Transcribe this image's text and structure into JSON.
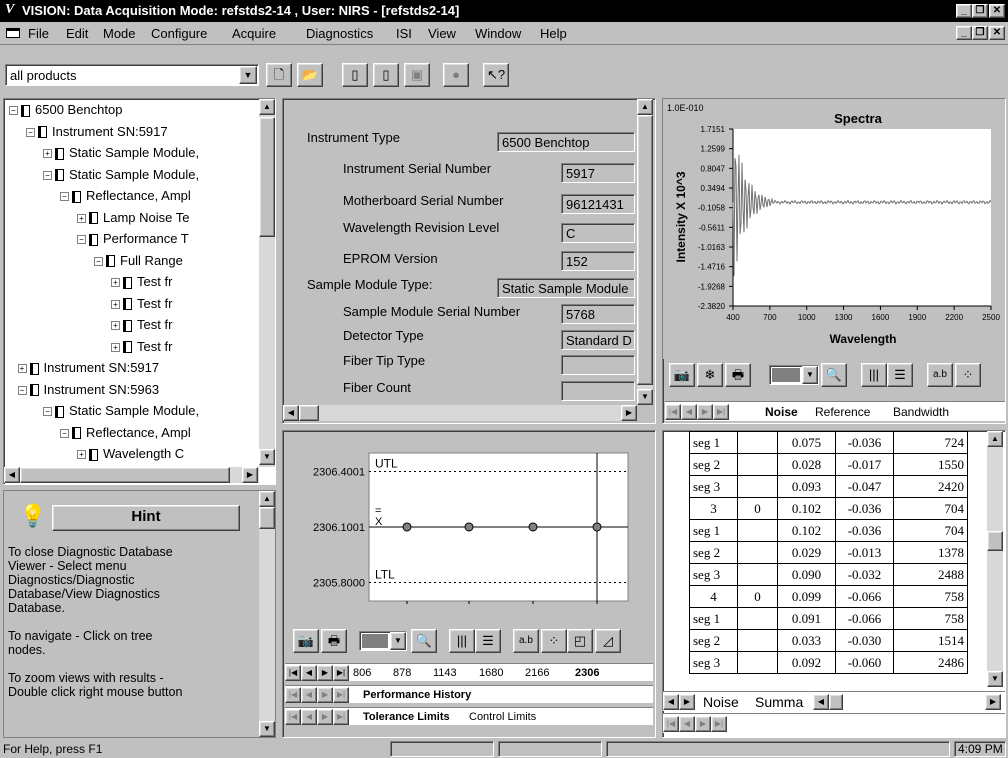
{
  "window": {
    "logo": "V",
    "title": "VISION: Data Acquisition Mode: refstds2-14 , User: NIRS - [refstds2-14]"
  },
  "menu": [
    "File",
    "Edit",
    "Mode",
    "Configure",
    "Acquire",
    "Diagnostics",
    "ISI",
    "View",
    "Window",
    "Help"
  ],
  "toolbar": {
    "product_filter": "all products"
  },
  "tree": [
    {
      "label": "6500 Benchtop",
      "level": 0,
      "pm": "−"
    },
    {
      "label": "Instrument SN:5917",
      "level": 1,
      "pm": "−"
    },
    {
      "label": "Static Sample Module,",
      "level": 2,
      "pm": "+"
    },
    {
      "label": "Static Sample Module,",
      "level": 2,
      "pm": "−"
    },
    {
      "label": "Reflectance, Ampl",
      "level": 3,
      "pm": "−"
    },
    {
      "label": "Lamp Noise Te",
      "level": 4,
      "pm": "+"
    },
    {
      "label": "Performance T",
      "level": 4,
      "pm": "−"
    },
    {
      "label": "Full Range",
      "level": 5,
      "pm": "−"
    },
    {
      "label": "Test fr",
      "level": 6,
      "pm": "+"
    },
    {
      "label": "Test fr",
      "level": 6,
      "pm": "+"
    },
    {
      "label": "Test fr",
      "level": 6,
      "pm": "+"
    },
    {
      "label": "Test fr",
      "level": 6,
      "pm": "+"
    },
    {
      "label": "Instrument SN:5917",
      "level": 0.5,
      "pm": "+"
    },
    {
      "label": "Instrument SN:5963",
      "level": 0.5,
      "pm": "−"
    },
    {
      "label": "Static Sample Module,",
      "level": 2,
      "pm": "−"
    },
    {
      "label": "Reflectance, Ampl",
      "level": 3,
      "pm": "−"
    },
    {
      "label": "Wavelength C",
      "level": 4,
      "pm": "+"
    }
  ],
  "hint": {
    "title": "Hint",
    "lines": [
      "To close Diagnostic Database",
      "Viewer - Select menu",
      "Diagnostics/Diagnostic",
      "Database/View Diagnostics",
      "Database.",
      "",
      "To navigate - Click on tree",
      "nodes.",
      "",
      "To zoom views with results -",
      "Double click right mouse button"
    ]
  },
  "info": {
    "instrument_type_label": "Instrument Type",
    "instrument_type_value": "6500 Benchtop",
    "serial_label": "Instrument Serial Number",
    "serial_value": "5917",
    "mb_label": "Motherboard Serial Number",
    "mb_value": "96121431",
    "wl_label": "Wavelength Revision Level",
    "wl_value": "C",
    "eprom_label": "EPROM Version",
    "eprom_value": "152",
    "smt_label": "Sample Module Type:",
    "smt_value": "Static Sample Module",
    "sms_label": "Sample Module Serial Number",
    "sms_value": "5768",
    "det_label": "Detector Type",
    "det_value": "Standard D",
    "fiber_tip_label": "Fiber Tip Type",
    "fiber_tip_value": "",
    "fiber_count_label": "Fiber Count",
    "fiber_count_value": ""
  },
  "tolerance_chart": {
    "utl_label": "UTL",
    "ltl_label": "LTL",
    "mean_marker": "=",
    "x_marker": "X",
    "tabs_wl": [
      "806",
      "878",
      "1143",
      "1680",
      "2166",
      "2306"
    ],
    "tab_history": "Performance History",
    "tab_tolerance": "Tolerance Limits",
    "tab_control": "Control Limits"
  },
  "chart_data": {
    "type": "line",
    "title": "Spectra",
    "xlabel": "Wavelength",
    "ylabel": "Intensity X 10^3",
    "top_label": "1.0E-010",
    "x_ticks": [
      "400",
      "700",
      "1000",
      "1300",
      "1600",
      "1900",
      "2200",
      "2500"
    ],
    "y_ticks": [
      "1.7151",
      "1.2599",
      "0.8047",
      "0.3494",
      "-0.1058",
      "-0.5611",
      "-1.0163",
      "-1.4716",
      "-1.9268",
      "-2.3820"
    ],
    "xlim": [
      400,
      2500
    ],
    "ylim": [
      -2.382,
      1.7151
    ],
    "series": [
      {
        "values": []
      }
    ]
  },
  "tolerance_data": {
    "type": "scatter",
    "y_ticks": [
      "2306.4001",
      "2306.1001",
      "2305.8000"
    ],
    "utl": 2306.4001,
    "ltl": 2305.8,
    "mean": 2306.1001,
    "points": [
      2306.1001,
      2306.1001,
      2306.1001,
      2306.1001
    ],
    "ylim": [
      2305.7,
      2306.5
    ]
  },
  "spectra_tabs": [
    "Noise",
    "Reference",
    "Bandwidth"
  ],
  "table": {
    "rows": [
      [
        "seg 1",
        "",
        "0.075",
        "-0.036",
        "724"
      ],
      [
        "seg 2",
        "",
        "0.028",
        "-0.017",
        "1550"
      ],
      [
        "seg 3",
        "",
        "0.093",
        "-0.047",
        "2420"
      ],
      [
        "3",
        "0",
        "0.102",
        "-0.036",
        "704"
      ],
      [
        "seg 1",
        "",
        "0.102",
        "-0.036",
        "704"
      ],
      [
        "seg 2",
        "",
        "0.029",
        "-0.013",
        "1378"
      ],
      [
        "seg 3",
        "",
        "0.090",
        "-0.032",
        "2488"
      ],
      [
        "4",
        "0",
        "0.099",
        "-0.066",
        "758"
      ],
      [
        "seg 1",
        "",
        "0.091",
        "-0.066",
        "758"
      ],
      [
        "seg 2",
        "",
        "0.033",
        "-0.030",
        "1514"
      ],
      [
        "seg 3",
        "",
        "0.092",
        "-0.060",
        "2486"
      ]
    ],
    "tabs": [
      "Noise",
      "Summa"
    ]
  },
  "status": {
    "help": "For Help, press F1",
    "time": "4:09 PM"
  }
}
